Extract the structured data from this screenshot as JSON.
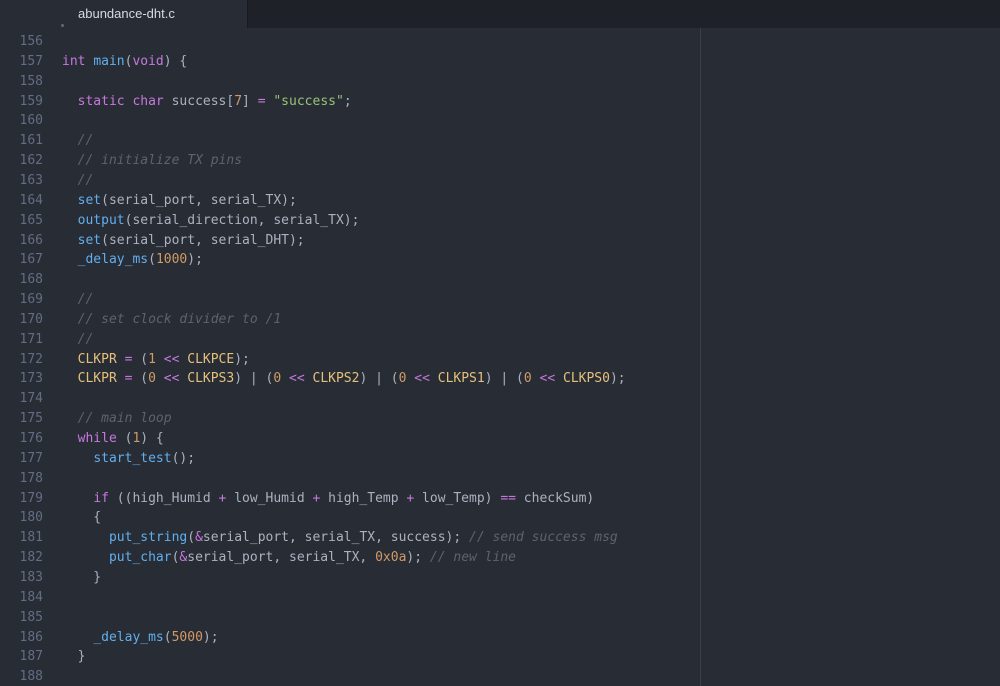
{
  "tab": {
    "title": "abundance-dht.c"
  },
  "colors": {
    "background": "#282c34",
    "tabbar": "#1e2127",
    "keyword": "#c678dd",
    "function": "#61afef",
    "string": "#98c379",
    "number": "#d19a66",
    "constant": "#e5c07b",
    "comment": "#5c6370",
    "text": "#abb2bf",
    "line_number": "#636d83"
  },
  "editor": {
    "lines": [
      {
        "num": "156",
        "tokens": []
      },
      {
        "num": "157",
        "tokens": [
          [
            "kw",
            "int"
          ],
          [
            "p",
            " "
          ],
          [
            "fn",
            "main"
          ],
          [
            "p",
            "("
          ],
          [
            "kw",
            "void"
          ],
          [
            "p",
            ") {"
          ]
        ]
      },
      {
        "num": "158",
        "tokens": []
      },
      {
        "num": "159",
        "tokens": [
          [
            "p",
            "  "
          ],
          [
            "kw",
            "static"
          ],
          [
            "p",
            " "
          ],
          [
            "kw",
            "char"
          ],
          [
            "p",
            " success["
          ],
          [
            "num",
            "7"
          ],
          [
            "p",
            "] "
          ],
          [
            "op",
            "="
          ],
          [
            "p",
            " "
          ],
          [
            "str",
            "\"success\""
          ],
          [
            "p",
            ";"
          ]
        ]
      },
      {
        "num": "160",
        "tokens": []
      },
      {
        "num": "161",
        "tokens": [
          [
            "p",
            "  "
          ],
          [
            "com",
            "//"
          ]
        ]
      },
      {
        "num": "162",
        "tokens": [
          [
            "p",
            "  "
          ],
          [
            "com",
            "// initialize TX pins"
          ]
        ]
      },
      {
        "num": "163",
        "tokens": [
          [
            "p",
            "  "
          ],
          [
            "com",
            "//"
          ]
        ]
      },
      {
        "num": "164",
        "tokens": [
          [
            "p",
            "  "
          ],
          [
            "fn",
            "set"
          ],
          [
            "p",
            "(serial_port, serial_TX);"
          ]
        ]
      },
      {
        "num": "165",
        "tokens": [
          [
            "p",
            "  "
          ],
          [
            "fn",
            "output"
          ],
          [
            "p",
            "(serial_direction, serial_TX);"
          ]
        ]
      },
      {
        "num": "166",
        "tokens": [
          [
            "p",
            "  "
          ],
          [
            "fn",
            "set"
          ],
          [
            "p",
            "(serial_port, serial_DHT);"
          ]
        ]
      },
      {
        "num": "167",
        "tokens": [
          [
            "p",
            "  "
          ],
          [
            "fn",
            "_delay_ms"
          ],
          [
            "p",
            "("
          ],
          [
            "num",
            "1000"
          ],
          [
            "p",
            ");"
          ]
        ]
      },
      {
        "num": "168",
        "tokens": []
      },
      {
        "num": "169",
        "tokens": [
          [
            "p",
            "  "
          ],
          [
            "com",
            "//"
          ]
        ]
      },
      {
        "num": "170",
        "tokens": [
          [
            "p",
            "  "
          ],
          [
            "com",
            "// set clock divider to /1"
          ]
        ]
      },
      {
        "num": "171",
        "tokens": [
          [
            "p",
            "  "
          ],
          [
            "com",
            "//"
          ]
        ]
      },
      {
        "num": "172",
        "tokens": [
          [
            "p",
            "  "
          ],
          [
            "const",
            "CLKPR"
          ],
          [
            "p",
            " "
          ],
          [
            "op",
            "="
          ],
          [
            "p",
            " ("
          ],
          [
            "num",
            "1"
          ],
          [
            "p",
            " "
          ],
          [
            "op",
            "<<"
          ],
          [
            "p",
            " "
          ],
          [
            "const",
            "CLKPCE"
          ],
          [
            "p",
            ");"
          ]
        ]
      },
      {
        "num": "173",
        "tokens": [
          [
            "p",
            "  "
          ],
          [
            "const",
            "CLKPR"
          ],
          [
            "p",
            " "
          ],
          [
            "op",
            "="
          ],
          [
            "p",
            " ("
          ],
          [
            "num",
            "0"
          ],
          [
            "p",
            " "
          ],
          [
            "op",
            "<<"
          ],
          [
            "p",
            " "
          ],
          [
            "const",
            "CLKPS3"
          ],
          [
            "p",
            ") | ("
          ],
          [
            "num",
            "0"
          ],
          [
            "p",
            " "
          ],
          [
            "op",
            "<<"
          ],
          [
            "p",
            " "
          ],
          [
            "const",
            "CLKPS2"
          ],
          [
            "p",
            ") | ("
          ],
          [
            "num",
            "0"
          ],
          [
            "p",
            " "
          ],
          [
            "op",
            "<<"
          ],
          [
            "p",
            " "
          ],
          [
            "const",
            "CLKPS1"
          ],
          [
            "p",
            ") | ("
          ],
          [
            "num",
            "0"
          ],
          [
            "p",
            " "
          ],
          [
            "op",
            "<<"
          ],
          [
            "p",
            " "
          ],
          [
            "const",
            "CLKPS0"
          ],
          [
            "p",
            ");"
          ]
        ]
      },
      {
        "num": "174",
        "tokens": []
      },
      {
        "num": "175",
        "tokens": [
          [
            "p",
            "  "
          ],
          [
            "com",
            "// main loop"
          ]
        ]
      },
      {
        "num": "176",
        "tokens": [
          [
            "p",
            "  "
          ],
          [
            "kw",
            "while"
          ],
          [
            "p",
            " ("
          ],
          [
            "num",
            "1"
          ],
          [
            "p",
            ") {"
          ]
        ]
      },
      {
        "num": "177",
        "tokens": [
          [
            "p",
            "    "
          ],
          [
            "fn",
            "start_test"
          ],
          [
            "p",
            "();"
          ]
        ]
      },
      {
        "num": "178",
        "tokens": []
      },
      {
        "num": "179",
        "tokens": [
          [
            "p",
            "    "
          ],
          [
            "kw",
            "if"
          ],
          [
            "p",
            " ((high_Humid "
          ],
          [
            "op",
            "+"
          ],
          [
            "p",
            " low_Humid "
          ],
          [
            "op",
            "+"
          ],
          [
            "p",
            " high_Temp "
          ],
          [
            "op",
            "+"
          ],
          [
            "p",
            " low_Temp) "
          ],
          [
            "op",
            "=="
          ],
          [
            "p",
            " checkSum)"
          ]
        ]
      },
      {
        "num": "180",
        "tokens": [
          [
            "p",
            "    {"
          ]
        ]
      },
      {
        "num": "181",
        "tokens": [
          [
            "p",
            "      "
          ],
          [
            "fn",
            "put_string"
          ],
          [
            "p",
            "("
          ],
          [
            "op",
            "&"
          ],
          [
            "p",
            "serial_port, serial_TX, success); "
          ],
          [
            "com",
            "// send success msg"
          ]
        ]
      },
      {
        "num": "182",
        "tokens": [
          [
            "p",
            "      "
          ],
          [
            "fn",
            "put_char"
          ],
          [
            "p",
            "("
          ],
          [
            "op",
            "&"
          ],
          [
            "p",
            "serial_port, serial_TX, "
          ],
          [
            "num",
            "0x0a"
          ],
          [
            "p",
            "); "
          ],
          [
            "com",
            "// new line"
          ]
        ]
      },
      {
        "num": "183",
        "tokens": [
          [
            "p",
            "    }"
          ]
        ]
      },
      {
        "num": "184",
        "tokens": []
      },
      {
        "num": "185",
        "tokens": []
      },
      {
        "num": "186",
        "tokens": [
          [
            "p",
            "    "
          ],
          [
            "fn",
            "_delay_ms"
          ],
          [
            "p",
            "("
          ],
          [
            "num",
            "5000"
          ],
          [
            "p",
            ");"
          ]
        ]
      },
      {
        "num": "187",
        "tokens": [
          [
            "p",
            "  }"
          ]
        ]
      },
      {
        "num": "188",
        "tokens": []
      }
    ]
  }
}
